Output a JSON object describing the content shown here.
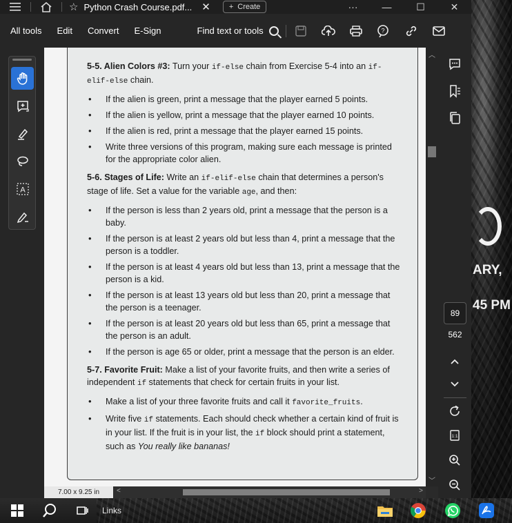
{
  "titlebar": {
    "tab_title": "Python Crash Course.pdf...",
    "create_label": "Create"
  },
  "menubar": {
    "items": [
      "All tools",
      "Edit",
      "Convert",
      "E-Sign"
    ],
    "find_label": "Find text or tools"
  },
  "document": {
    "ex55_title": "5-5. Alien Colors #3:",
    "ex55_t1": " Turn your ",
    "ex55_code1": "if-else",
    "ex55_t2": " chain from Exercise 5-4 into an ",
    "ex55_code2": "if-elif-else",
    "ex55_t3": " chain.",
    "ex55_bullets": [
      "If the alien is green, print a message that the player earned 5 points.",
      "If the alien is yellow, print a message that the player earned 10 points.",
      "If the alien is red, print a message that the player earned 15 points.",
      "Write three versions of this program, making sure each message is printed for the appropriate color alien."
    ],
    "ex56_title": "5-6. Stages of Life:",
    "ex56_t1": " Write an ",
    "ex56_code1": "if-elif-else",
    "ex56_t2": " chain that determines a person's stage of life. Set a value for the variable ",
    "ex56_code2": "age",
    "ex56_t3": ", and then:",
    "ex56_bullets": [
      "If the person is less than 2 years old, print a message that the person is a baby.",
      "If the person is at least 2 years old but less than 4, print a message that the person is a toddler.",
      "If the person is at least 4 years old but less than 13, print a message that the person is a kid.",
      "If the person is at least 13 years old but less than 20, print a message that the person is a teenager.",
      "If the person is at least 20 years old but less than 65, print a message that the person is an adult.",
      "If the person is age 65 or older, print a message that the person is an elder."
    ],
    "ex57_title": "5-7. Favorite Fruit:",
    "ex57_t1": " Make a list of your favorite fruits, and then write a series of independent ",
    "ex57_code1": "if",
    "ex57_t2": " statements that check for certain fruits in your list.",
    "ex57_b1_text": "Make a list of your three favorite fruits and call it ",
    "ex57_b1_code": "favorite_fruits",
    "ex57_b1_end": ".",
    "ex57_b2_t1": "Write five ",
    "ex57_b2_code1": "if",
    "ex57_b2_t2": " statements. Each should check whether a certain kind of fruit is in your list. If the fruit is in your list, the ",
    "ex57_b2_code2": "if",
    "ex57_b2_t3": " block should print a statement, such as ",
    "ex57_b2_em": "You really like bananas!"
  },
  "statusbar": {
    "page_size": "7.00 x 9.25 in"
  },
  "navigation": {
    "current_page": "89",
    "total_pages": "562"
  },
  "taskbar": {
    "links_label": "Links"
  },
  "wallpaper": {
    "text1": "ARY,",
    "text2": "45 PM"
  },
  "colors": {
    "accent": "#2a72d6",
    "page_bg": "#e8eaea",
    "chrome_bg": "#262626"
  }
}
